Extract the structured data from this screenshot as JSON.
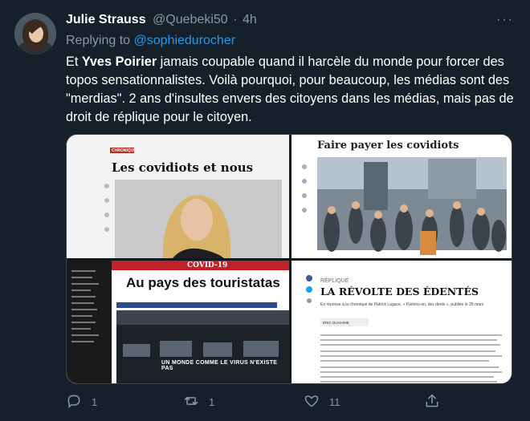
{
  "tweet": {
    "author_name": "Julie Strauss",
    "author_handle": "@Quebeki50",
    "separator": "·",
    "time": "4h",
    "more_label": "···",
    "replying_prefix": "Replying to",
    "replying_handle": "@sophiedurocher",
    "text_part1": "Et ",
    "text_bold": "Yves Poirier",
    "text_part2": " jamais coupable quand il harcèle du monde pour forcer des topos sensationnalistes. Voilà pourquoi, pour beaucoup, les médias sont des \"merdias\". 2 ans d'insultes envers des citoyens dans les médias, mais pas de droit de réplique pour le citoyen."
  },
  "media": {
    "panel1": {
      "tag": "CHRONIQUE",
      "headline": "Les covidiots et nous"
    },
    "panel2": {
      "headline": "Faire payer les covidiots"
    },
    "panel3": {
      "banner": "COVID-19",
      "headline": "Au pays des touristatas",
      "photo_caption": "UN MONDE COMME LE VIRUS N'EXISTE PAS"
    },
    "panel4": {
      "tag": "RÉPLIQUE",
      "headline": "LA RÉVOLTE DES ÉDENTÉS",
      "intro": "En réponse à la chronique de Patrick Lagacé, « Parlons-en, des dents », publiée le 25 mars",
      "author": "ÉRIC DUHAIME"
    }
  },
  "actions": {
    "reply_count": "1",
    "retweet_count": "1",
    "like_count": "11"
  },
  "colors": {
    "background": "#15202b",
    "text_primary": "#ffffff",
    "text_secondary": "#8899a6",
    "link": "#1d9bf0"
  },
  "icons": [
    "reply-icon",
    "retweet-icon",
    "like-icon",
    "share-icon",
    "more-icon"
  ]
}
